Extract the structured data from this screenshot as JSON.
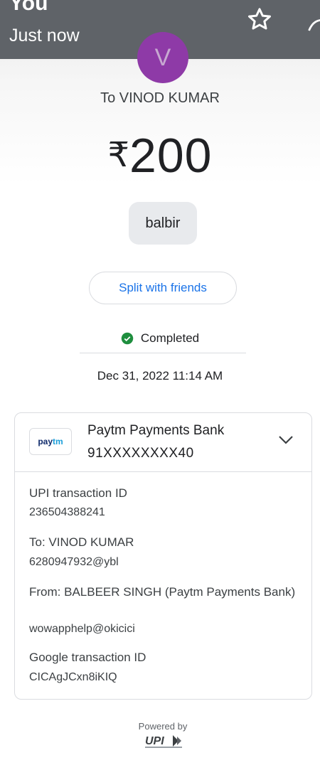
{
  "header": {
    "sender": "You",
    "time": "Just now"
  },
  "avatar": {
    "initial": "V",
    "color": "#8e3aa7"
  },
  "payment": {
    "to_line": "To VINOD KUMAR",
    "currency": "₹",
    "amount": "200",
    "note": "balbir",
    "split_label": "Split with friends",
    "status": "Completed",
    "datetime": "Dec 31, 2022 11:14 AM"
  },
  "bank": {
    "logo_pay": "pay",
    "logo_tm": "tm",
    "name": "Paytm Payments Bank",
    "account": "91XXXXXXXX40"
  },
  "details": {
    "upi_label": "UPI transaction ID",
    "upi_value": "236504388241",
    "to_label": "To: VINOD KUMAR",
    "to_value": "6280947932@ybl",
    "from_label": "From: BALBEER SINGH (Paytm Payments Bank)",
    "from_value": "wowapphelp@okicici",
    "google_label": "Google transaction ID",
    "google_value": "CICAgJCxn8iKIQ"
  },
  "footer": {
    "powered_by": "Powered by",
    "upi_logo_text": "UPI"
  },
  "colors": {
    "header_bg": "#5f6368",
    "accent_blue": "#1a73e8",
    "success_green": "#1e8e3e"
  },
  "icons": {
    "star": "star-outline-icon",
    "share": "share-icon",
    "check": "check-circle-icon",
    "chevron": "chevron-down-icon"
  }
}
